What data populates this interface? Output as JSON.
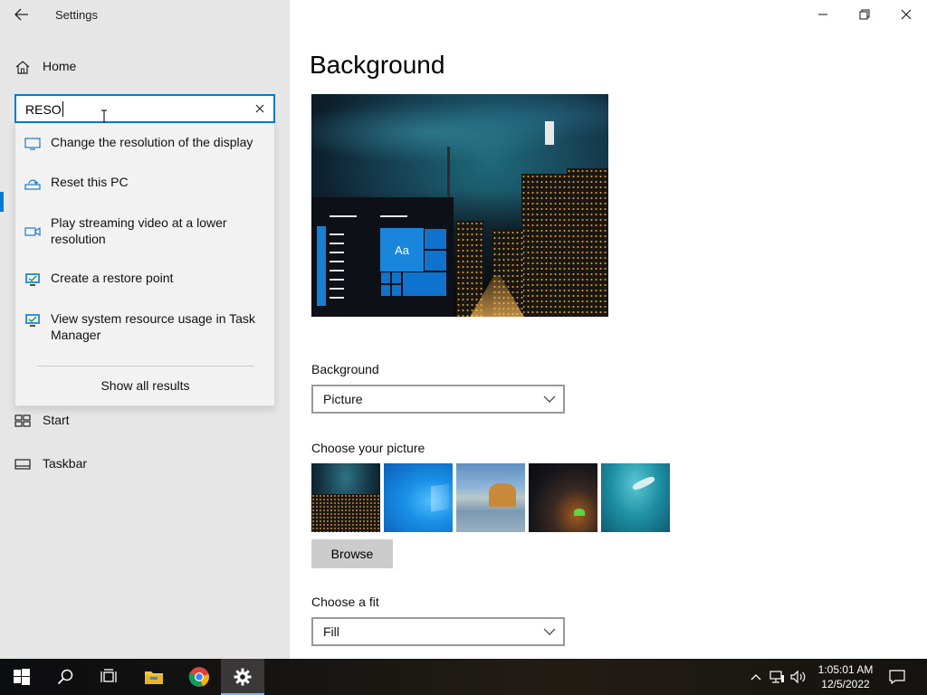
{
  "window": {
    "app_title": "Settings",
    "controls": [
      "minimize-icon",
      "restore-icon",
      "close-icon"
    ]
  },
  "sidebar": {
    "home_label": "Home",
    "search": {
      "value": "RESO",
      "placeholder": ""
    },
    "suggestions": [
      {
        "icon": "monitor-icon",
        "label": "Change the resolution of the display"
      },
      {
        "icon": "reset-pc-icon",
        "label": "Reset this PC"
      },
      {
        "icon": "video-icon",
        "label": "Play streaming video at a lower resolution"
      },
      {
        "icon": "system-monitor-icon",
        "label": "Create a restore point"
      },
      {
        "icon": "system-monitor-icon",
        "label": "View system resource usage in Task Manager"
      }
    ],
    "show_all_label": "Show all results",
    "items": [
      {
        "icon": "start-icon",
        "label": "Start"
      },
      {
        "icon": "taskbar-icon",
        "label": "Taskbar"
      }
    ]
  },
  "main": {
    "page_title": "Background",
    "preview": {
      "tile_label": "Aa"
    },
    "background_section": {
      "label": "Background",
      "selected": "Picture"
    },
    "picture_section": {
      "label": "Choose your picture",
      "thumbnails": [
        "city-night",
        "windows-blue",
        "beach-rock",
        "night-sky-tent",
        "underwater-swimmer"
      ],
      "browse_label": "Browse"
    },
    "fit_section": {
      "label": "Choose a fit",
      "selected": "Fill"
    }
  },
  "taskbar": {
    "apps": [
      "windows-start-icon",
      "search-icon",
      "task-view-icon",
      "file-explorer-icon",
      "chrome-icon",
      "settings-gear-icon"
    ],
    "active_app": "settings-gear-icon",
    "tray": [
      "chevron-up-icon",
      "network-icon",
      "volume-icon"
    ],
    "time": "1:05:01 AM",
    "date": "12/5/2022",
    "notification_icon": "action-center-icon"
  },
  "colors": {
    "accent": "#0078d7",
    "sidebar_bg": "#e6e6e6",
    "dropdown_bg": "#f2f2f2",
    "button_bg": "#cccccc"
  }
}
